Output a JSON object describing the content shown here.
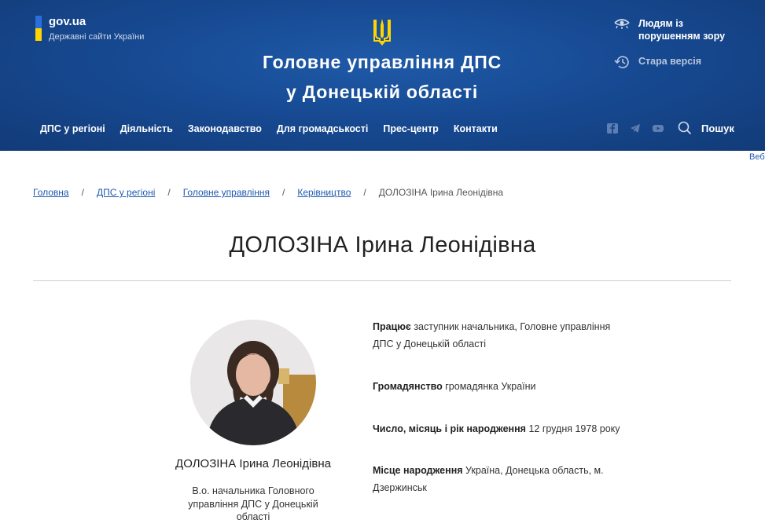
{
  "gov": {
    "title": "gov.ua",
    "subtitle": "Державні сайти України"
  },
  "org": {
    "title_line1": "Головне управління ДПС",
    "title_line2": "у Донецькій області"
  },
  "top_links": {
    "accessibility": "Людям із порушенням зору",
    "old_version": "Стара версія"
  },
  "nav": {
    "items": [
      "ДПС у регіоні",
      "Діяльність",
      "Законодавство",
      "Для громадськості",
      "Прес-центр",
      "Контакти"
    ]
  },
  "social": [
    "facebook-icon",
    "telegram-icon",
    "youtube-icon"
  ],
  "search": {
    "label": "Пошук"
  },
  "edge_text": "Веб",
  "breadcrumb": {
    "items": [
      "Головна",
      "ДПС у регіоні",
      "Головне управління",
      "Керівництво"
    ],
    "separator": "/",
    "current": "ДОЛОЗІНА Ірина Леонідівна"
  },
  "page_title": "ДОЛОЗІНА Ірина Леонідівна",
  "person": {
    "name": "ДОЛОЗІНА Ірина Леонідівна",
    "position": "В.о. начальника Головного управління ДПС у Донецькій області"
  },
  "details": [
    {
      "label": "Працює",
      "value": "заступник начальника, Головне управління ДПС у Донецькій області"
    },
    {
      "label": "Громадянство",
      "value": "громадянка України"
    },
    {
      "label": "Число, місяць і рік народження",
      "value": "12 грудня 1978 року"
    },
    {
      "label": "Місце народження",
      "value": "Україна, Донецька область, м. Дзержинськ"
    }
  ],
  "colors": {
    "header_bg": "#174a93",
    "link": "#1f5ab0",
    "flag_blue": "#2a6fdb",
    "flag_yellow": "#ffd500"
  }
}
